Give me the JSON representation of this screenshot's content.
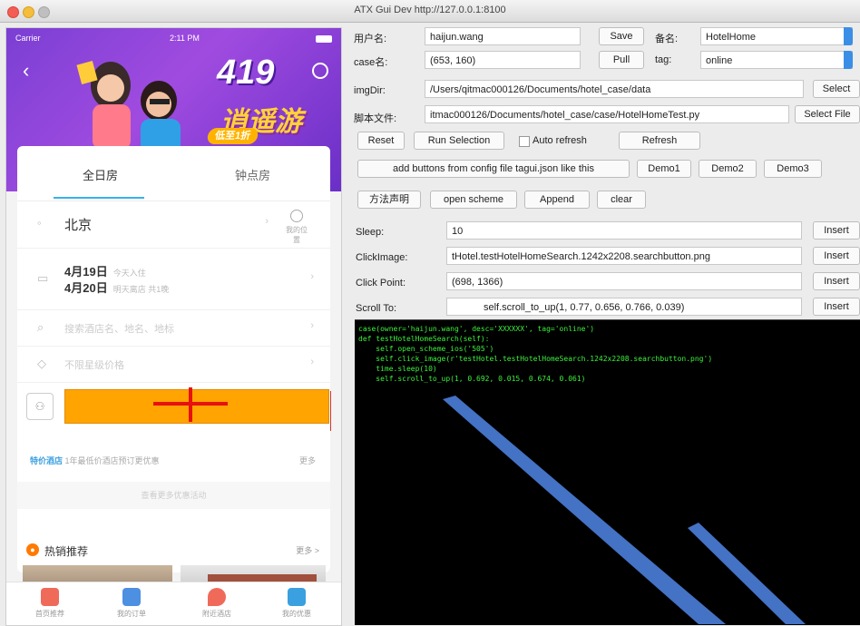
{
  "window": {
    "title": "ATX Gui Dev http://127.0.0.1:8100"
  },
  "colors": {
    "accent": "#3a8ee6",
    "orange_button": "#ffa400",
    "crosshair": "#e8100e",
    "terminal_text": "#3cf23c",
    "banner_purple": "#8a45d8",
    "arrow_blue": "#4472c4"
  },
  "phone": {
    "status": {
      "carrier": "Carrier",
      "time": "2:11 PM"
    },
    "banner": {
      "number": "419",
      "title": "逍遥游",
      "badge": "低至1折"
    },
    "tabs": {
      "active": "全日房",
      "inactive": "钟点房"
    },
    "city": "北京",
    "location_label": "我的位置",
    "dates": {
      "checkin": "4月19日",
      "checkin_sub": "今天入住",
      "checkout": "4月20日",
      "checkout_sub": "明天离店 共1晚"
    },
    "keyword_placeholder": "搜索酒店名、地名、地标",
    "price_placeholder": "不限星级价格",
    "person_icon": "person-icon",
    "promo": {
      "tag": "特价酒店",
      "text": "1年最低价酒店预订更优惠",
      "more": "更多"
    },
    "faint_text": "查看更多优惠活动",
    "hot": {
      "title": "热销推荐",
      "more": "更多 >"
    },
    "tabbar": [
      {
        "label": "首页推荐",
        "icon": "home-icon",
        "color": "#f06a5a"
      },
      {
        "label": "我的订单",
        "icon": "order-icon",
        "color": "#4d8fe0"
      },
      {
        "label": "附近酒店",
        "icon": "location-icon",
        "color": "#f06a5a"
      },
      {
        "label": "我的优惠",
        "icon": "coupon-icon",
        "color": "#3aa0e0"
      }
    ]
  },
  "form": {
    "user_label": "用户名:",
    "user_value": "haijun.wang",
    "save_label": "Save",
    "alias_label": "备名:",
    "alias_value": "HotelHome",
    "case_label": "case名:",
    "case_value": "(653, 160)",
    "pull_label": "Pull",
    "tag_label": "tag:",
    "tag_value": "online",
    "imgdir_label": "imgDir:",
    "imgdir_value": "/Users/qitmac000126/Documents/hotel_case/data",
    "select_label": "Select",
    "script_label": "脚本文件:",
    "script_value": "itmac000126/Documents/hotel_case/case/HotelHomeTest.py",
    "select_file_label": "Select File",
    "reset_label": "Reset",
    "run_selection_label": "Run Selection",
    "auto_refresh_label": "Auto refresh",
    "refresh_label": "Refresh",
    "add_buttons_label": "add buttons from config file tagui.json like this",
    "demo1_label": "Demo1",
    "demo2_label": "Demo2",
    "demo3_label": "Demo3",
    "method_label": "方法声明",
    "open_scheme_label": "open scheme",
    "append_label": "Append",
    "clear_label": "clear",
    "sleep_label": "Sleep:",
    "sleep_value": "10",
    "click_image_label": "ClickImage:",
    "click_image_value": "tHotel.testHotelHomeSearch.1242x2208.searchbutton.png",
    "click_point_label": "Click Point:",
    "click_point_value": "(698, 1366)",
    "scroll_label": "Scroll To:",
    "scroll_value": "self.scroll_to_up(1, 0.77, 0.656, 0.766, 0.039)",
    "insert_label": "Insert"
  },
  "terminal": {
    "code": "case(owner='haijun.wang', desc='XXXXXX', tag='online')\ndef testHotelHomeSearch(self):\n    self.open_scheme_ios('505')\n    self.click_image(r'testHotel.testHotelHomeSearch.1242x2208.searchbutton.png')\n    time.sleep(10)\n    self.scroll_to_up(1, 0.692, 0.015, 0.674, 0.061)"
  }
}
